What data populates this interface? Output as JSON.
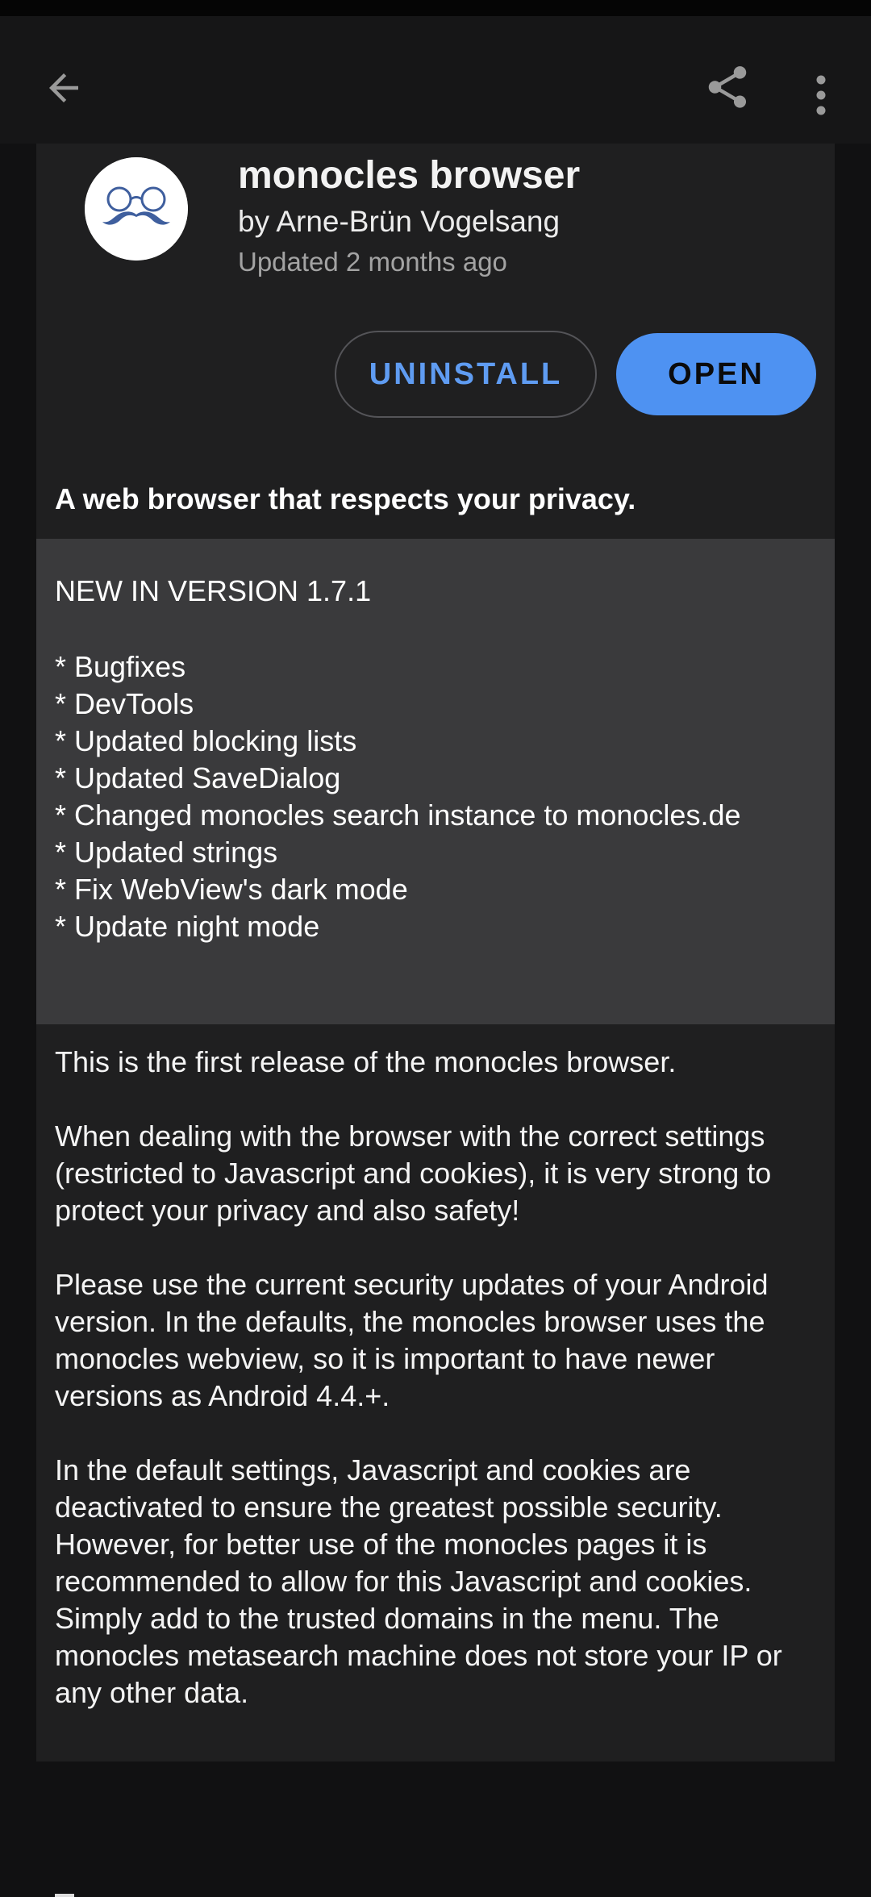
{
  "colors": {
    "accent": "#4e92f2",
    "background": "#111112",
    "card": "#1f1f20",
    "whats_new_panel": "#3a3a3c"
  },
  "toolbar": {
    "back_icon": "arrow-left-icon",
    "share_icon": "share-icon",
    "more_icon": "more-vertical-icon"
  },
  "app": {
    "icon": "monocles-glasses-mustache-logo",
    "name": "monocles browser",
    "author": "by Arne-Brün Vogelsang",
    "updated": "Updated 2 months ago"
  },
  "actions": {
    "uninstall_label": "UNINSTALL",
    "open_label": "OPEN"
  },
  "summary": "A web browser that respects your privacy.",
  "whats_new": {
    "heading": "NEW IN VERSION 1.7.1",
    "items": [
      "* Bugfixes",
      "* DevTools",
      "* Updated blocking lists",
      "* Updated SaveDialog",
      "* Changed monocles search instance to monocles.de",
      "* Updated strings",
      "* Fix WebView's dark mode",
      "* Update night mode"
    ]
  },
  "description": {
    "paragraphs": [
      "This is the first release of the monocles browser.",
      "When dealing with the browser with the correct settings (restricted to Javascript and cookies), it is very strong to protect your privacy and also safety!",
      "Please use the current security updates of your Android version. In the defaults, the monocles browser uses the monocles webview, so it is important to have newer versions as Android 4.4.+.",
      "In the default settings, Javascript and cookies are deactivated to ensure the greatest possible security. However, for better use of the monocles pages it is recommended to allow for this Javascript and cookies. Simply add to the trusted domains in the menu. The monocles metasearch machine does not store your IP or any other data."
    ]
  }
}
